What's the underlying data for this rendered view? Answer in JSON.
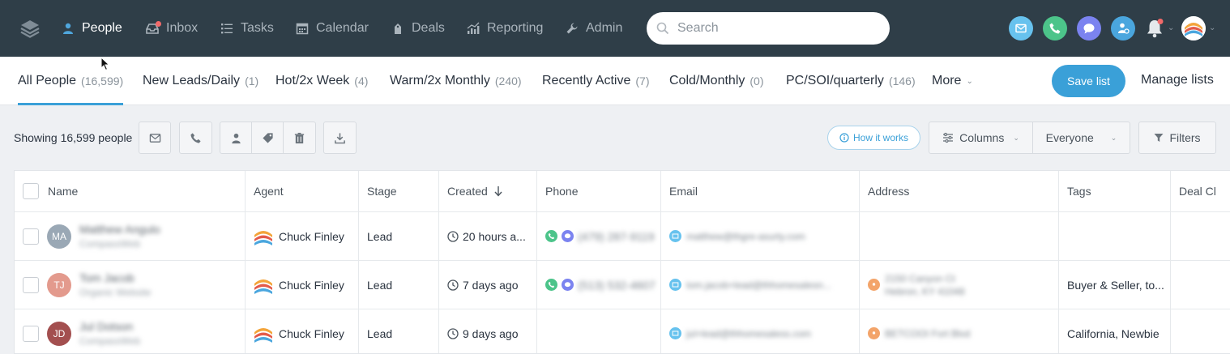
{
  "nav": {
    "items": [
      {
        "label": "People",
        "icon": "person-icon",
        "active": true
      },
      {
        "label": "Inbox",
        "icon": "inbox-icon",
        "badge": true
      },
      {
        "label": "Tasks",
        "icon": "tasks-icon"
      },
      {
        "label": "Calendar",
        "icon": "calendar-icon"
      },
      {
        "label": "Deals",
        "icon": "deals-icon"
      },
      {
        "label": "Reporting",
        "icon": "reporting-icon"
      },
      {
        "label": "Admin",
        "icon": "wrench-icon"
      }
    ],
    "search_placeholder": "Search",
    "quick_actions": [
      {
        "icon": "email-icon",
        "color": "#67c2ee"
      },
      {
        "icon": "phone-icon",
        "color": "#4cc48a"
      },
      {
        "icon": "chat-icon",
        "color": "#7b83f0"
      },
      {
        "icon": "agent-icon",
        "color": "#4aa6de"
      }
    ],
    "accent": "#3aa0d8"
  },
  "lists": {
    "tabs": [
      {
        "label": "All People",
        "count": "(16,599)",
        "active": true
      },
      {
        "label": "New Leads/Daily",
        "count": "(1)"
      },
      {
        "label": "Hot/2x Week",
        "count": "(4)"
      },
      {
        "label": "Warm/2x Monthly",
        "count": "(240)"
      },
      {
        "label": "Recently Active",
        "count": "(7)"
      },
      {
        "label": "Cold/Monthly",
        "count": "(0)"
      },
      {
        "label": "PC/SOI/quarterly",
        "count": "(146)"
      }
    ],
    "more_label": "More",
    "save_label": "Save list",
    "manage_label": "Manage lists"
  },
  "toolbar": {
    "showing_text": "Showing 16,599 people",
    "how_it_works": "How it works",
    "columns_label": "Columns",
    "everyone_label": "Everyone",
    "filters_label": "Filters"
  },
  "table": {
    "columns": [
      "Name",
      "Agent",
      "Stage",
      "Created",
      "Phone",
      "Email",
      "Address",
      "Tags",
      "Deal Cl"
    ],
    "rows": [
      {
        "initials": "MA",
        "avatar_color": "#9aa8b5",
        "name": "Matthew Angulo",
        "source": "CompassWeb",
        "agent": "Chuck Finley",
        "stage": "Lead",
        "created": "20 hours a...",
        "phone": "(479) 287-9119",
        "email": "matthew@thgre-asurty.com",
        "address_1": "",
        "address_2": "",
        "tags": ""
      },
      {
        "initials": "TJ",
        "avatar_color": "#e39a8d",
        "name": "Tom Jacob",
        "source": "Organic Website",
        "agent": "Chuck Finley",
        "stage": "Lead",
        "created": "7 days ago",
        "phone": "(513) 532-4607",
        "email": "tom.jacob+lead@thhomesalesn...",
        "address_1": "2150 Canyon Ct",
        "address_2": "Hebron, KY 41048",
        "tags": "Buyer & Seller, to..."
      },
      {
        "initials": "JD",
        "avatar_color": "#a34f4f",
        "name": "Jul Dotson",
        "source": "CompassWeb",
        "agent": "Chuck Finley",
        "stage": "Lead",
        "created": "9 days ago",
        "phone": "",
        "email": "jul+lead@thhomesaless.com",
        "address_1": "BETCOOI Fort Blvd",
        "address_2": "",
        "tags": "California, Newbie"
      }
    ]
  }
}
